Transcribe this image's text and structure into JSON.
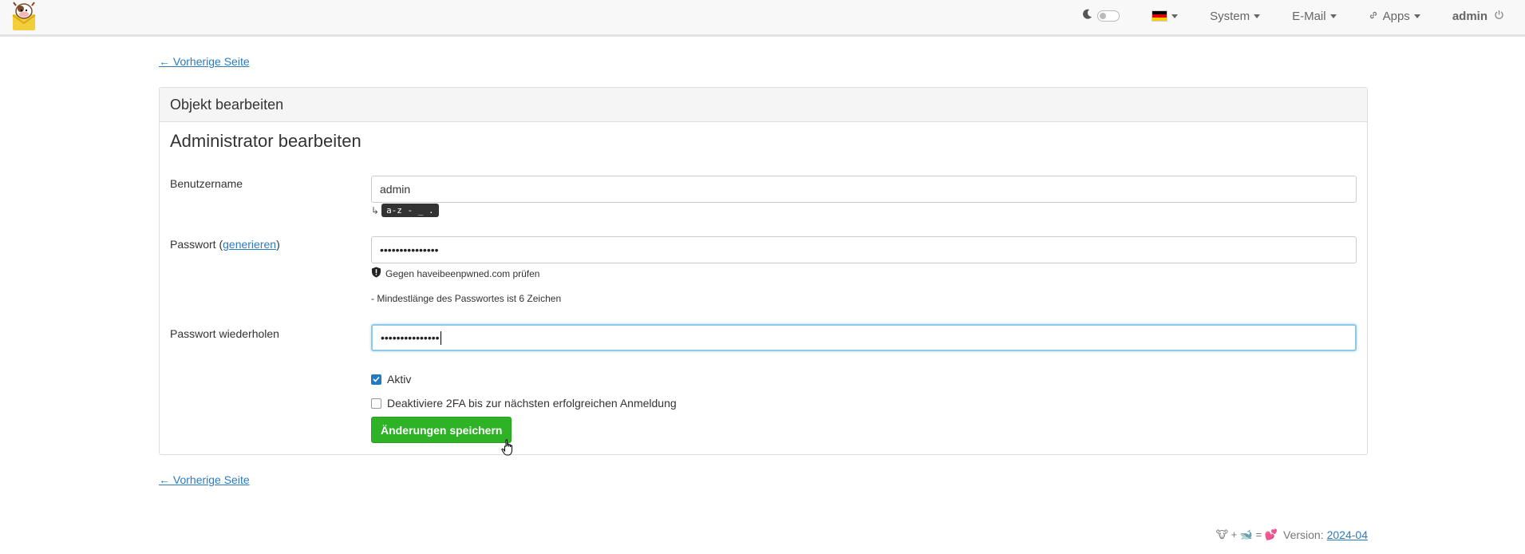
{
  "nav": {
    "language_flag": "de",
    "system_label": "System",
    "email_label": "E-Mail",
    "apps_label": "Apps",
    "user_label": "admin"
  },
  "back_link": "← Vorherige Seite",
  "panel": {
    "heading": "Objekt bearbeiten",
    "title": "Administrator bearbeiten"
  },
  "form": {
    "username_label": "Benutzername",
    "username_value": "admin",
    "username_pattern_hint": "a-z - _ .",
    "password_label_prefix": "Passwort (",
    "password_generate_link": "generieren",
    "password_label_suffix": ")",
    "password_value": "•••••••••••••••",
    "hibp_check": "Gegen haveibeenpwned.com prüfen",
    "min_length_note": "- Mindestlänge des Passwortes ist 6 Zeichen",
    "password_repeat_label": "Passwort wiederholen",
    "password_repeat_value": "•••••••••••••••",
    "active_label": "Aktiv",
    "active_checked": true,
    "disable_2fa_label": "Deaktiviere 2FA bis zur nächsten erfolgreichen Anmeldung",
    "disable_2fa_checked": false,
    "save_button": "Änderungen speichern"
  },
  "footer": {
    "emoji_text": "🐮 + 🐋 = 💕",
    "version_label": "Version:",
    "version_link": "2024-04"
  },
  "colors": {
    "accent_link": "#2a7bbf",
    "save_button": "#2db325",
    "checkbox_checked": "#1f7cc0"
  }
}
